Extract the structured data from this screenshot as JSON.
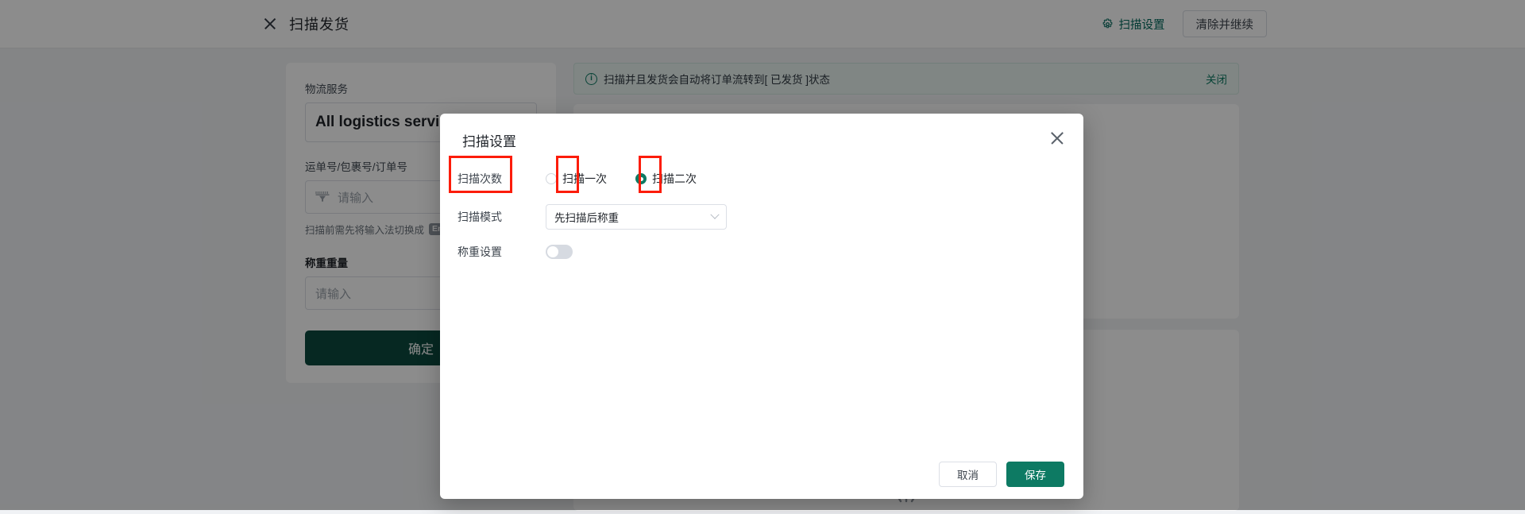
{
  "header": {
    "close_icon": "close-icon",
    "title": "扫描发货",
    "scan_settings_label": "扫描设置",
    "gear_icon": "gear-icon",
    "clear_continue_label": "清除并继续"
  },
  "left_form": {
    "logistics_label": "物流服务",
    "logistics_value": "All logistics services",
    "tracking_label": "运单号/包裹号/订单号",
    "tracking_placeholder": "请输入",
    "scan_icon": "barcode-scanner-icon",
    "ime_hint": "扫描前需先将输入法切换成",
    "ime_badge": "En",
    "weight_label": "称重重量",
    "weight_placeholder": "请输入",
    "confirm_label": "确定"
  },
  "right_panel": {
    "alert_icon": "info-circle-icon",
    "alert_text": "扫描并且发货会自动将订单流转到[ 已发货 ]状态",
    "alert_close_label": "关闭"
  },
  "modal": {
    "title": "扫描设置",
    "close_icon": "close-icon",
    "rows": {
      "scan_count": {
        "label": "扫描次数",
        "options": [
          {
            "label": "扫描一次",
            "selected": false
          },
          {
            "label": "扫描二次",
            "selected": true
          }
        ]
      },
      "scan_mode": {
        "label": "扫描模式",
        "value": "先扫描后称重",
        "caret_icon": "chevron-down-icon"
      },
      "weigh_setting": {
        "label": "称重设置",
        "enabled": false
      }
    },
    "footer": {
      "cancel_label": "取消",
      "save_label": "保存"
    }
  },
  "colors": {
    "brand_green": "#0d7a63",
    "dark_green": "#0b4a3f",
    "annotation_red": "#fc1c09",
    "overlay": "rgba(0,0,0,0.45)"
  }
}
